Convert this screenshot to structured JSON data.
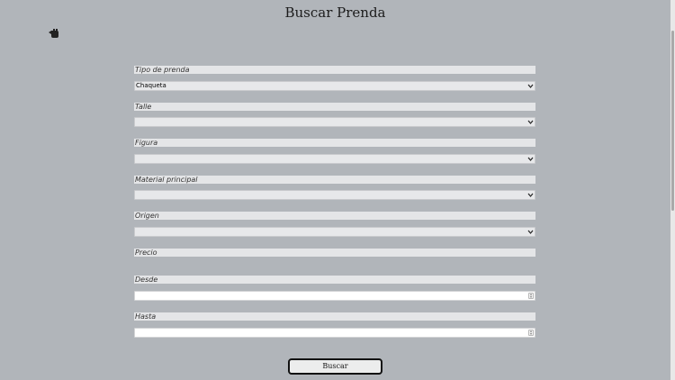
{
  "page": {
    "title": "Buscar Prenda"
  },
  "icons": {
    "back": "back-hand-icon"
  },
  "form": {
    "tipo_label": "Tipo de prenda",
    "tipo_value": "Chaqueta",
    "talle_label": "Talle",
    "talle_value": "",
    "figura_label": "Figura",
    "figura_value": "",
    "material_label": "Material principal",
    "material_value": "",
    "origen_label": "Origen",
    "origen_value": "",
    "precio_label": "Precio",
    "desde_label": "Desde",
    "desde_value": "",
    "hasta_label": "Hasta",
    "hasta_value": "",
    "submit_label": "Buscar"
  }
}
